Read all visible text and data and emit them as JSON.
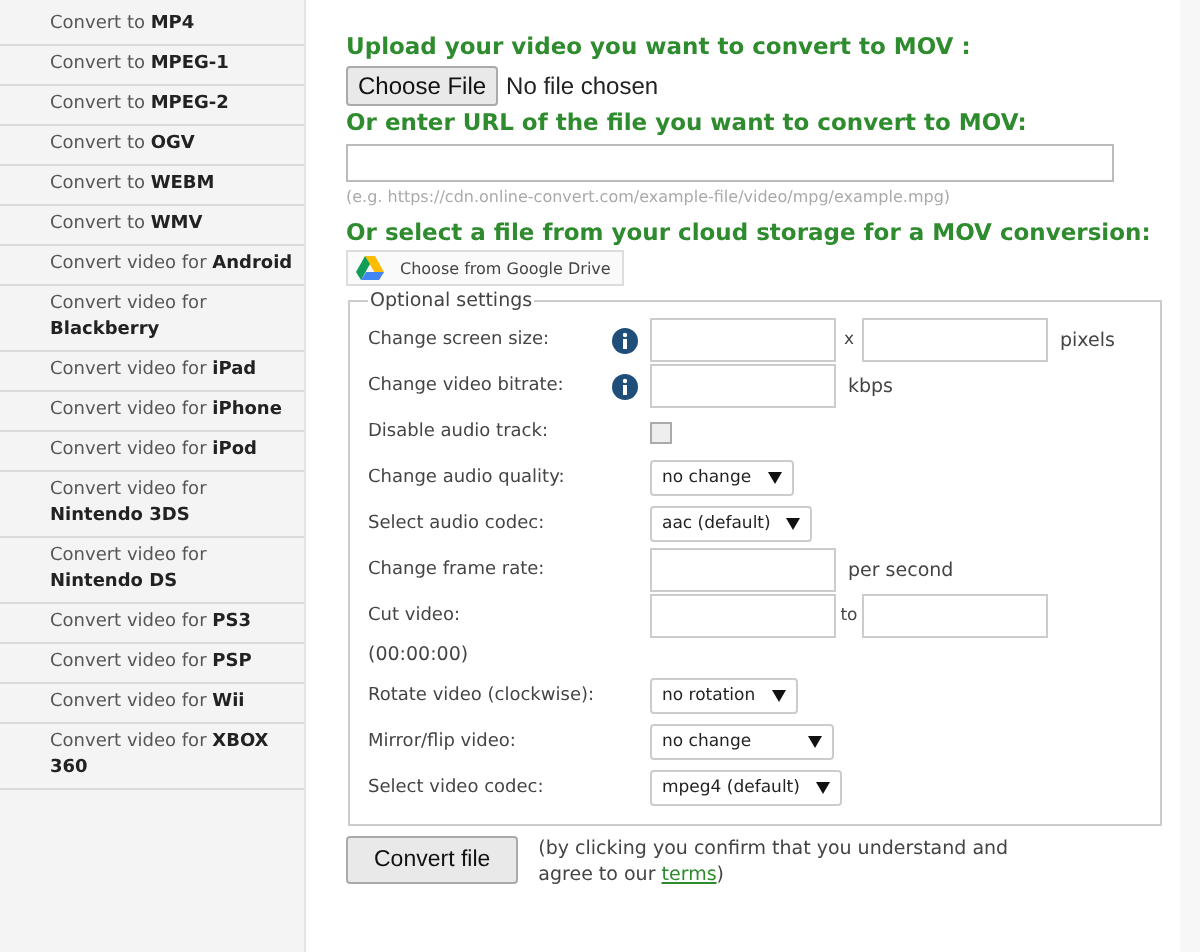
{
  "sidebar": {
    "items": [
      {
        "label": "Convert to **MP4**"
      },
      {
        "label": "Convert to **MPEG-1**"
      },
      {
        "label": "Convert to **MPEG-2**"
      },
      {
        "label": "Convert to **OGV**"
      },
      {
        "label": "Convert to **WEBM**"
      },
      {
        "label": "Convert to **WMV**"
      },
      {
        "label": "Convert video for **Android**"
      },
      {
        "label": "Convert video for **Blackberry**"
      },
      {
        "label": "Convert video for **iPad**"
      },
      {
        "label": "Convert video for **iPhone**"
      },
      {
        "label": "Convert video for **iPod**"
      },
      {
        "label": "Convert video for **Nintendo 3DS**"
      },
      {
        "label": "Convert video for **Nintendo DS**"
      },
      {
        "label": "Convert video for **PS3**"
      },
      {
        "label": "Convert video for **PSP**"
      },
      {
        "label": "Convert video for **Wii**"
      },
      {
        "label": "Convert video for **XBOX 360**"
      }
    ]
  },
  "upload": {
    "heading": "Upload your video you want to convert to MOV :",
    "button": "Choose File",
    "status": "No file chosen"
  },
  "url": {
    "heading": "Or enter URL of the file you want to convert to MOV:",
    "hint": "(e.g. https://cdn.online-convert.com/example-file/video/mpg/example.mpg)"
  },
  "cloud": {
    "heading": "Or select a file from your cloud storage for a MOV conversion:",
    "button": "Choose from Google Drive"
  },
  "settings": {
    "legend": "Optional settings",
    "rows": [
      {
        "kind": "size",
        "label": "Change screen size:",
        "info": true,
        "separator": "x",
        "unit": "pixels"
      },
      {
        "kind": "input",
        "label": "Change video bitrate:",
        "info": true,
        "unit": "kbps"
      },
      {
        "kind": "checkbox",
        "label": "Disable audio track:",
        "checked": false
      },
      {
        "kind": "select",
        "label": "Change audio quality:",
        "value": "no change"
      },
      {
        "kind": "select",
        "label": "Select audio codec:",
        "value": "aac (default)"
      },
      {
        "kind": "input",
        "label": "Change frame rate:",
        "info": false,
        "unit": "per second"
      },
      {
        "kind": "range",
        "label": "Cut video:",
        "separator": "to",
        "note": "(00:00:00)"
      },
      {
        "kind": "select",
        "label": "Rotate video (clockwise):",
        "value": "no rotation"
      },
      {
        "kind": "select",
        "label": "Mirror/flip video:",
        "value": "no change",
        "wide": true
      },
      {
        "kind": "select",
        "label": "Select video codec:",
        "value": "mpeg4 (default)"
      }
    ]
  },
  "submit": {
    "button": "Convert file",
    "note": "(by clicking you confirm that you understand and",
    "note2": "agree to our",
    "link": "terms",
    "close": ")"
  }
}
